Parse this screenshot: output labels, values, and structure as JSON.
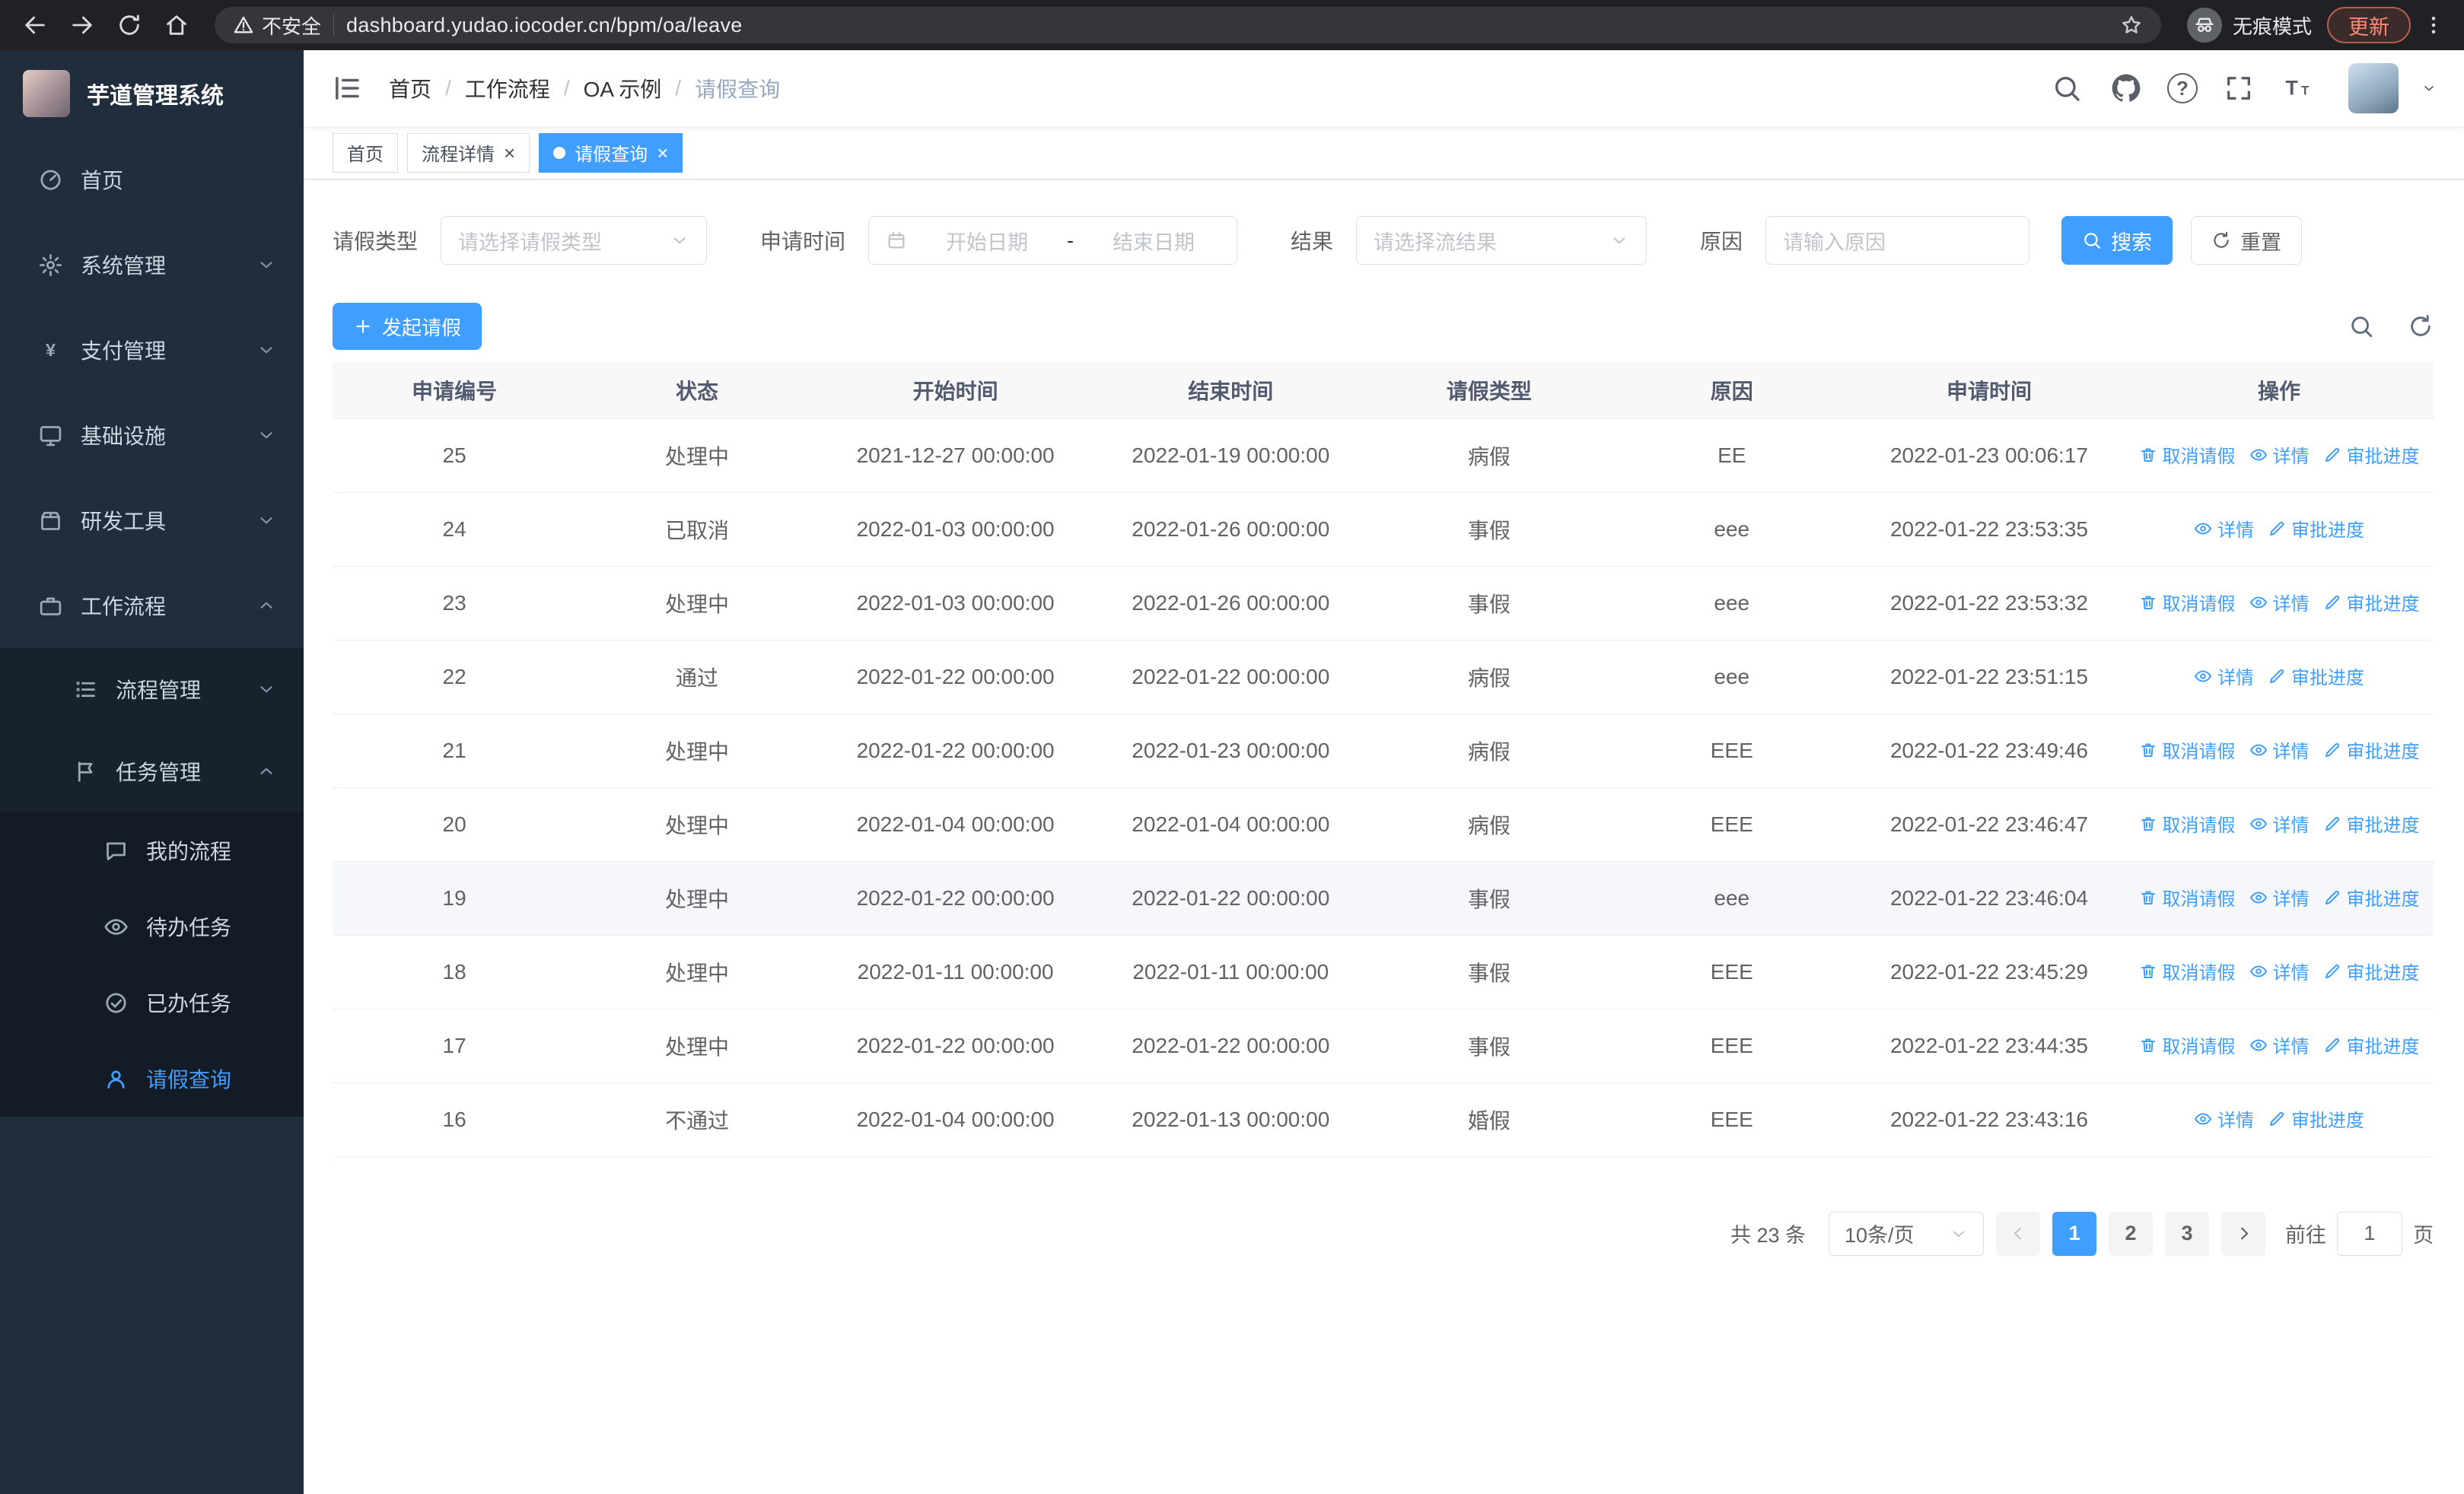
{
  "browser": {
    "security_label": "不安全",
    "url": "dashboard.yudao.iocoder.cn/bpm/oa/leave",
    "incognito_label": "无痕模式",
    "update_label": "更新"
  },
  "sidebar": {
    "logo_title": "芋道管理系统",
    "menu": [
      {
        "label": "首页",
        "icon": "dashboard",
        "level": 1
      },
      {
        "label": "系统管理",
        "icon": "gear",
        "level": 1,
        "chevron": "down"
      },
      {
        "label": "支付管理",
        "icon": "yen",
        "level": 1,
        "chevron": "down"
      },
      {
        "label": "基础设施",
        "icon": "monitor",
        "level": 1,
        "chevron": "down"
      },
      {
        "label": "研发工具",
        "icon": "tools",
        "level": 1,
        "chevron": "down"
      },
      {
        "label": "工作流程",
        "icon": "workflow",
        "level": 1,
        "chevron": "up"
      },
      {
        "label": "流程管理",
        "icon": "list",
        "level": 2,
        "chevron": "down"
      },
      {
        "label": "任务管理",
        "icon": "flag",
        "level": 2,
        "chevron": "up"
      },
      {
        "label": "我的流程",
        "icon": "chat",
        "level": 3
      },
      {
        "label": "待办任务",
        "icon": "eye",
        "level": 3
      },
      {
        "label": "已办任务",
        "icon": "done",
        "level": 3
      },
      {
        "label": "请假查询",
        "icon": "user",
        "level": 3,
        "active": true
      }
    ]
  },
  "header": {
    "breadcrumb": [
      "首页",
      "工作流程",
      "OA 示例",
      "请假查询"
    ]
  },
  "tabs": [
    {
      "label": "首页",
      "closable": false,
      "active": false
    },
    {
      "label": "流程详情",
      "closable": true,
      "active": false
    },
    {
      "label": "请假查询",
      "closable": true,
      "active": true
    }
  ],
  "filters": {
    "leave_type_label": "请假类型",
    "leave_type_placeholder": "请选择请假类型",
    "apply_time_label": "申请时间",
    "start_date_placeholder": "开始日期",
    "date_separator": "-",
    "end_date_placeholder": "结束日期",
    "result_label": "结果",
    "result_placeholder": "请选择流结果",
    "reason_label": "原因",
    "reason_placeholder": "请输入原因",
    "search_label": "搜索",
    "reset_label": "重置"
  },
  "toolbar": {
    "create_label": "发起请假"
  },
  "table": {
    "columns": [
      "申请编号",
      "状态",
      "开始时间",
      "结束时间",
      "请假类型",
      "原因",
      "申请时间",
      "操作"
    ],
    "action_labels": {
      "cancel": "取消请假",
      "detail": "详情",
      "progress": "审批进度"
    },
    "rows": [
      {
        "id": "25",
        "status": "处理中",
        "start": "2021-12-27 00:00:00",
        "end": "2022-01-19 00:00:00",
        "type": "病假",
        "reason": "EE",
        "applied": "2022-01-23 00:06:17",
        "actions": [
          "cancel",
          "detail",
          "progress"
        ]
      },
      {
        "id": "24",
        "status": "已取消",
        "start": "2022-01-03 00:00:00",
        "end": "2022-01-26 00:00:00",
        "type": "事假",
        "reason": "eee",
        "applied": "2022-01-22 23:53:35",
        "actions": [
          "detail",
          "progress"
        ]
      },
      {
        "id": "23",
        "status": "处理中",
        "start": "2022-01-03 00:00:00",
        "end": "2022-01-26 00:00:00",
        "type": "事假",
        "reason": "eee",
        "applied": "2022-01-22 23:53:32",
        "actions": [
          "cancel",
          "detail",
          "progress"
        ]
      },
      {
        "id": "22",
        "status": "通过",
        "start": "2022-01-22 00:00:00",
        "end": "2022-01-22 00:00:00",
        "type": "病假",
        "reason": "eee",
        "applied": "2022-01-22 23:51:15",
        "actions": [
          "detail",
          "progress"
        ]
      },
      {
        "id": "21",
        "status": "处理中",
        "start": "2022-01-22 00:00:00",
        "end": "2022-01-23 00:00:00",
        "type": "病假",
        "reason": "EEE",
        "applied": "2022-01-22 23:49:46",
        "actions": [
          "cancel",
          "detail",
          "progress"
        ]
      },
      {
        "id": "20",
        "status": "处理中",
        "start": "2022-01-04 00:00:00",
        "end": "2022-01-04 00:00:00",
        "type": "病假",
        "reason": "EEE",
        "applied": "2022-01-22 23:46:47",
        "actions": [
          "cancel",
          "detail",
          "progress"
        ]
      },
      {
        "id": "19",
        "status": "处理中",
        "start": "2022-01-22 00:00:00",
        "end": "2022-01-22 00:00:00",
        "type": "事假",
        "reason": "eee",
        "applied": "2022-01-22 23:46:04",
        "actions": [
          "cancel",
          "detail",
          "progress"
        ],
        "highlight": true
      },
      {
        "id": "18",
        "status": "处理中",
        "start": "2022-01-11 00:00:00",
        "end": "2022-01-11 00:00:00",
        "type": "事假",
        "reason": "EEE",
        "applied": "2022-01-22 23:45:29",
        "actions": [
          "cancel",
          "detail",
          "progress"
        ]
      },
      {
        "id": "17",
        "status": "处理中",
        "start": "2022-01-22 00:00:00",
        "end": "2022-01-22 00:00:00",
        "type": "事假",
        "reason": "EEE",
        "applied": "2022-01-22 23:44:35",
        "actions": [
          "cancel",
          "detail",
          "progress"
        ]
      },
      {
        "id": "16",
        "status": "不通过",
        "start": "2022-01-04 00:00:00",
        "end": "2022-01-13 00:00:00",
        "type": "婚假",
        "reason": "EEE",
        "applied": "2022-01-22 23:43:16",
        "actions": [
          "detail",
          "progress"
        ]
      }
    ]
  },
  "pagination": {
    "total_label": "共 23 条",
    "page_size_label": "10条/页",
    "pages": [
      "1",
      "2",
      "3"
    ],
    "active_page": "1",
    "goto_label": "前往",
    "goto_value": "1",
    "page_unit_label": "页"
  },
  "colors": {
    "accent": "#409eff",
    "sidebar_bg": "#1f2d3d",
    "chrome_bg": "#202124",
    "update_red": "#ff8a76"
  }
}
